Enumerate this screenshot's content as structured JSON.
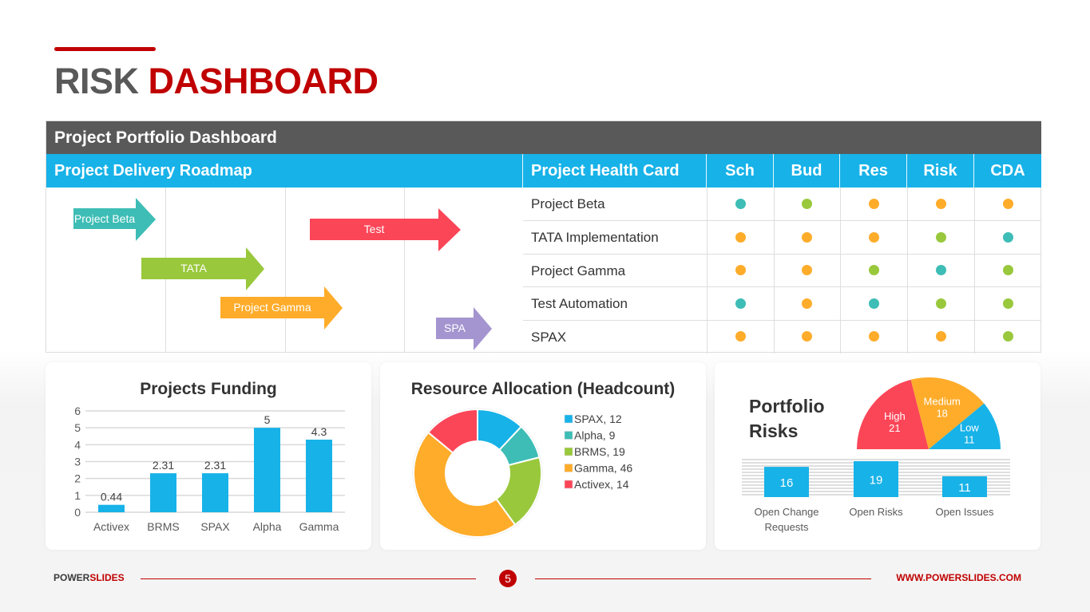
{
  "title": {
    "part1": "RISK",
    "part2": "DASHBOARD"
  },
  "portfolio": {
    "header": "Project Portfolio Dashboard",
    "roadmap_title": "Project Delivery Roadmap",
    "roadmap_arrows": [
      {
        "label": "Project Beta",
        "color": "#3dbdb5"
      },
      {
        "label": "Test",
        "color": "#fb4658"
      },
      {
        "label": "TATA",
        "color": "#99c83c"
      },
      {
        "label": "Project Gamma",
        "color": "#feac2a"
      },
      {
        "label": "SPA",
        "color": "#a495d0"
      }
    ],
    "health_card_title": "Project Health Card",
    "health_columns": [
      "Sch",
      "Bud",
      "Res",
      "Risk",
      "CDA"
    ],
    "status_colors": {
      "teal": "#3dbdb5",
      "green": "#99c83c",
      "orange": "#feac2a"
    },
    "health_rows": [
      {
        "name": "Project Beta",
        "status": [
          "teal",
          "green",
          "orange",
          "orange",
          "orange"
        ]
      },
      {
        "name": "TATA Implementation",
        "status": [
          "orange",
          "orange",
          "orange",
          "green",
          "teal"
        ]
      },
      {
        "name": "Project Gamma",
        "status": [
          "orange",
          "orange",
          "green",
          "teal",
          "green"
        ]
      },
      {
        "name": "Test Automation",
        "status": [
          "teal",
          "orange",
          "teal",
          "green",
          "green"
        ]
      },
      {
        "name": "SPAX",
        "status": [
          "orange",
          "orange",
          "orange",
          "orange",
          "green"
        ]
      }
    ]
  },
  "chart_data": [
    {
      "type": "bar",
      "title": "Projects Funding",
      "categories": [
        "Activex",
        "BRMS",
        "SPAX",
        "Alpha",
        "Gamma"
      ],
      "values": [
        0.44,
        2.31,
        2.31,
        5,
        4.3
      ],
      "data_labels": [
        "0.44",
        "2.31",
        "2.31",
        "5",
        "4.3"
      ],
      "xlabel": "",
      "ylabel": "",
      "ylim": [
        0,
        6
      ],
      "yticks": [
        "0",
        "1",
        "2",
        "3",
        "4",
        "5",
        "6"
      ],
      "grid": true,
      "color": "#17b2e8"
    },
    {
      "type": "pie",
      "title": "Resource Allocation (Headcount)",
      "donut": true,
      "labels": [
        "SPAX",
        "Alpha",
        "BRMS",
        "Gamma",
        "Activex"
      ],
      "values": [
        12,
        9,
        19,
        46,
        14
      ],
      "legend_labels": [
        "SPAX, 12",
        "Alpha, 9",
        "BRMS, 19",
        "Gamma, 46",
        "Activex, 14"
      ],
      "colors": [
        "#17b2e8",
        "#3dbdb5",
        "#99c83c",
        "#feac2a",
        "#fb4658"
      ],
      "legend": "right"
    },
    {
      "type": "pie",
      "title": "Portfolio Risks",
      "half_pie": true,
      "labels": [
        "High",
        "Medium",
        "Low"
      ],
      "values": [
        21,
        18,
        11
      ],
      "colors": [
        "#fb4658",
        "#feac2a",
        "#17b2e8"
      ]
    },
    {
      "type": "bar",
      "title": "",
      "categories": [
        "Open Change Requests",
        "Open Risks",
        "Open Issues"
      ],
      "values": [
        16,
        19,
        11
      ],
      "data_labels": [
        "16",
        "19",
        "11"
      ],
      "color": "#17b2e8"
    }
  ],
  "risk_card": {
    "title_line1": "Portfolio",
    "title_line2": "Risks",
    "count_labels_line1": [
      "Open Change",
      "Open Risks",
      "Open Issues"
    ],
    "count_labels_line2": [
      "Requests",
      "",
      ""
    ]
  },
  "footer": {
    "brand_part1": "POWER",
    "brand_part2": "SLIDES",
    "page_number": "5",
    "url": "WWW.POWERSLIDES.COM"
  }
}
